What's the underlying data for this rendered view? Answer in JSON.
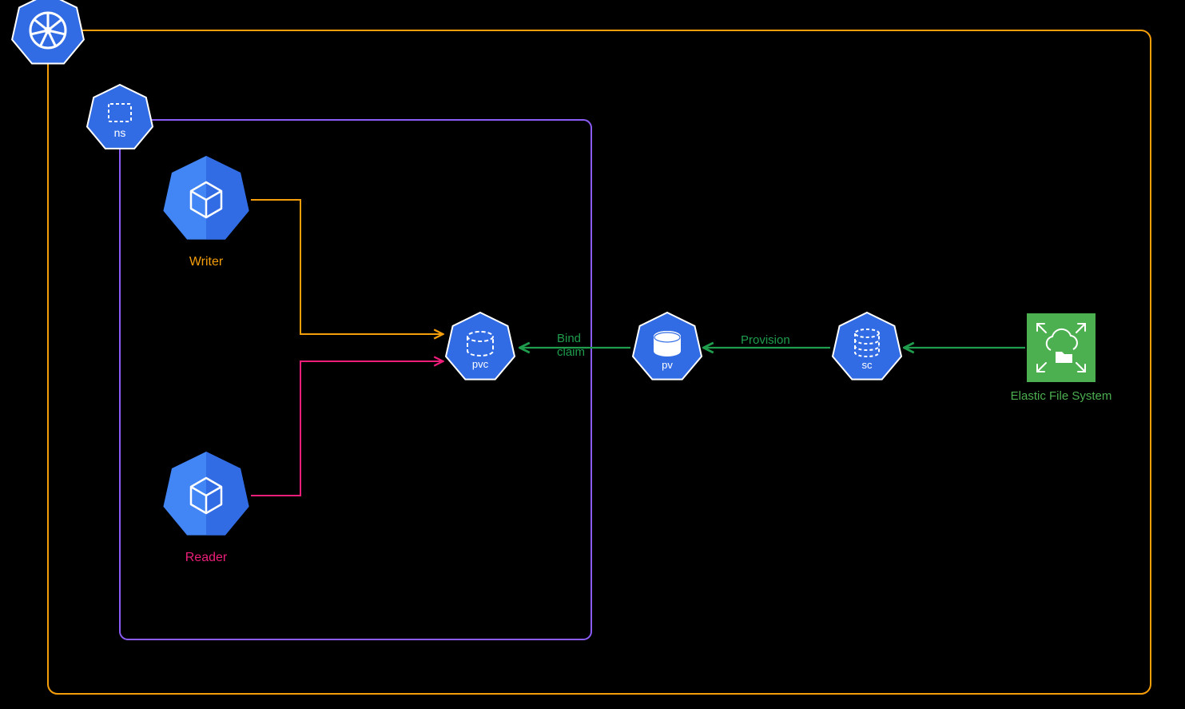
{
  "nodes": {
    "ns": {
      "label": "ns"
    },
    "writer": {
      "label": "Writer"
    },
    "reader": {
      "label": "Reader"
    },
    "pvc": {
      "label": "pvc"
    },
    "pv": {
      "label": "pv"
    },
    "sc": {
      "label": "sc"
    },
    "efs": {
      "label": "Elastic File System"
    }
  },
  "edges": {
    "bind": {
      "line1": "Bind",
      "line2": "claim"
    },
    "provision": {
      "label": "Provision"
    }
  },
  "colors": {
    "orange": "#f59e0b",
    "purple": "#8b5cf6",
    "pink": "#ec1e79",
    "green": "#1f9d4d",
    "awsGreen": "#4caf50",
    "blue": "#326ce5",
    "blueLight": "#4285f4"
  }
}
